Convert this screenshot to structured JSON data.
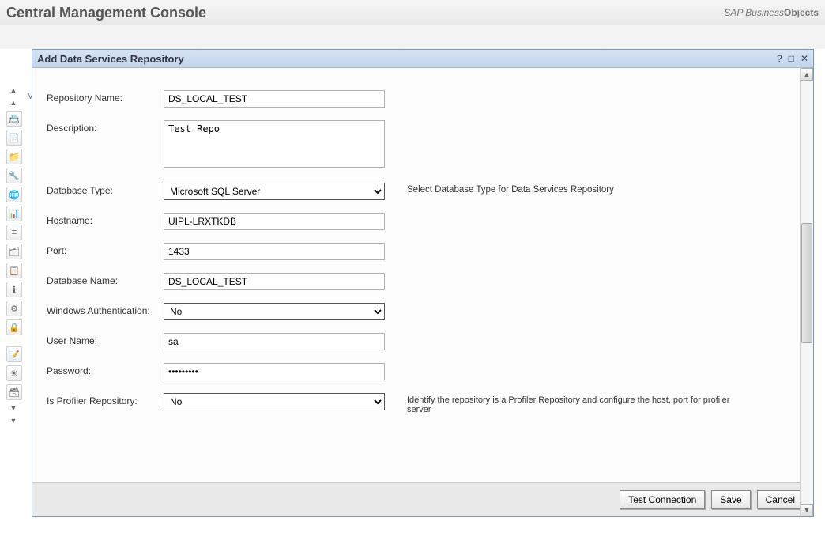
{
  "header": {
    "title": "Central Management Console",
    "branding_prefix": "SAP Business",
    "branding_suffix": "Objects"
  },
  "dialog": {
    "title": "Add Data Services Repository",
    "help_glyph": "?",
    "max_glyph": "□",
    "close_glyph": "✕"
  },
  "form": {
    "repo_name": {
      "label": "Repository Name:",
      "value": "DS_LOCAL_TEST"
    },
    "description": {
      "label": "Description:",
      "value": "Test Repo"
    },
    "db_type": {
      "label": "Database Type:",
      "value": "Microsoft SQL Server",
      "hint": "Select Database Type for Data Services Repository"
    },
    "hostname": {
      "label": "Hostname:",
      "value": "UIPL-LRXTKDB"
    },
    "port": {
      "label": "Port:",
      "value": "1433"
    },
    "db_name": {
      "label": "Database Name:",
      "value": "DS_LOCAL_TEST"
    },
    "win_auth": {
      "label": "Windows Authentication:",
      "value": "No"
    },
    "user_name": {
      "label": "User Name:",
      "value": "sa"
    },
    "password": {
      "label": "Password:",
      "value": "•••••••••"
    },
    "is_profiler": {
      "label": "Is Profiler Repository:",
      "value": "No",
      "hint": "Identify the repository is a Profiler Repository and configure the host, port for profiler server"
    }
  },
  "buttons": {
    "test": "Test Connection",
    "save": "Save",
    "cancel": "Cancel"
  },
  "background": {
    "faint_tab": "Ma"
  },
  "icons": {
    "t1": "▲",
    "t2": "▲",
    "i1": "📇",
    "i2": "📄",
    "i3": "📁",
    "i4": "🔧",
    "i5": "🌐",
    "i6": "📊",
    "i7": "≡",
    "i8": "🗂",
    "i9": "📋",
    "i10": "ℹ",
    "i11": "⚙",
    "i12": "🔒",
    "i13": "📝",
    "i14": "✳",
    "i15": "🗃",
    "b1": "▼",
    "b2": "▼"
  }
}
